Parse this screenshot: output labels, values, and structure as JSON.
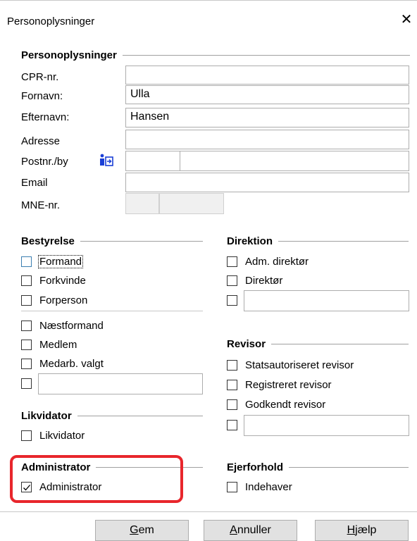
{
  "window": {
    "title": "Personoplysninger",
    "close_glyph": "✕"
  },
  "personal": {
    "group_title": "Personoplysninger",
    "cpr_label": "CPR-nr.",
    "firstname_label": "Fornavn:",
    "firstname_value": "Ulla",
    "lastname_label": "Efternavn:",
    "lastname_value": "Hansen",
    "address_label": "Adresse",
    "postal_label": "Postnr./by",
    "email_label": "Email",
    "mne_label": "MNE-nr.",
    "info_icon": "info-lookup-icon"
  },
  "board": {
    "group_title": "Bestyrelse",
    "items": [
      "Formand",
      "Forkvinde",
      "Forperson",
      "Næstformand",
      "Medlem",
      "Medarb. valgt"
    ]
  },
  "direction": {
    "group_title": "Direktion",
    "items": [
      "Adm. direktør",
      "Direktør"
    ]
  },
  "auditor": {
    "group_title": "Revisor",
    "items": [
      "Statsautoriseret revisor",
      "Registreret revisor",
      "Godkendt revisor"
    ]
  },
  "liquidator": {
    "group_title": "Likvidator",
    "item": "Likvidator"
  },
  "administrator": {
    "group_title": "Administrator",
    "item": "Administrator",
    "checked": true
  },
  "ownership": {
    "group_title": "Ejerforhold",
    "item": "Indehaver"
  },
  "buttons": {
    "save_first": "G",
    "save_rest": "em",
    "cancel_first": "A",
    "cancel_rest": "nnuller",
    "help_first": "H",
    "help_rest": "jælp"
  },
  "colors": {
    "highlight": "#e8262c",
    "info_icon": "#1a3fd6"
  }
}
